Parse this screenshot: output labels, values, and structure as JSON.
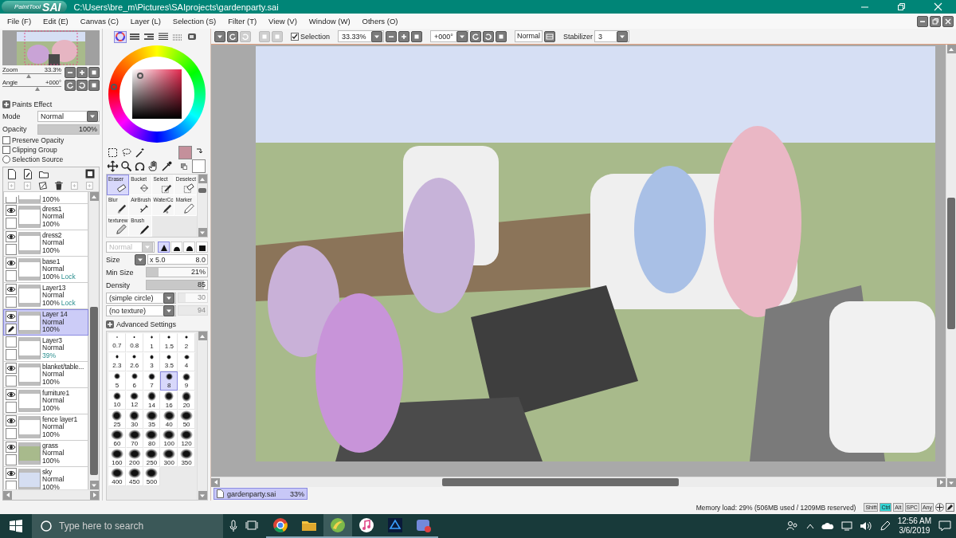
{
  "window": {
    "logo_small": "PaintTool",
    "logo_big": "SAI",
    "title": "C:\\Users\\bre_m\\Pictures\\SAIprojects\\gardenparty.sai"
  },
  "menu": [
    "File (F)",
    "Edit (E)",
    "Canvas (C)",
    "Layer (L)",
    "Selection (S)",
    "Filter (T)",
    "View (V)",
    "Window (W)",
    "Others (O)"
  ],
  "toolbar": {
    "selection": {
      "label": "Selection",
      "checked": true
    },
    "zoom": "33.33%",
    "angle": "+000°",
    "blend": "Normal",
    "stabilizer_label": "Stabilizer",
    "stabilizer": "3"
  },
  "navigator": {
    "sliders": [
      {
        "label": "Zoom",
        "reading": "33.3%",
        "level": 0.45
      },
      {
        "label": "Angle",
        "reading": "+000°",
        "level": 0.6
      }
    ]
  },
  "paints_effect": {
    "title": "Paints Effect",
    "mode_label": "Mode",
    "mode": "Normal",
    "opacity_label": "Opacity",
    "opacity": "100%",
    "level": 1,
    "options": [
      {
        "label": "Preserve Opacity",
        "kind": "checkbox",
        "checked": false
      },
      {
        "label": "Clipping Group",
        "kind": "checkbox",
        "checked": false
      },
      {
        "label": "Selection Source",
        "kind": "radio",
        "checked": false
      }
    ]
  },
  "layers": [
    {
      "kind": "cut",
      "opacity": "100%"
    },
    {
      "kind": "layer",
      "name": "dress1",
      "mode": "Normal",
      "opacity": "100%",
      "visible": true,
      "selected": false,
      "color": "#ffffff"
    },
    {
      "kind": "layer",
      "name": "dress2",
      "mode": "Normal",
      "opacity": "100%",
      "visible": true,
      "selected": false,
      "color": "#ffffff"
    },
    {
      "kind": "layer",
      "name": "base1",
      "mode": "Normal",
      "opacity": "100%",
      "lock": "Lock",
      "visible": true,
      "selected": false,
      "color": "#ffffff"
    },
    {
      "kind": "layer",
      "name": "Layer13",
      "mode": "Normal",
      "opacity": "100%",
      "lock": "Lock",
      "visible": true,
      "selected": false,
      "color": "#ffffff"
    },
    {
      "kind": "layer",
      "name": "Layer 14",
      "mode": "Normal",
      "opacity": "100%",
      "visible": true,
      "selected": true,
      "color": "#ffffff"
    },
    {
      "kind": "layer",
      "name": "Layer3",
      "mode": "Normal",
      "opacity": "39%",
      "opacity_modified": true,
      "visible": false,
      "selected": false,
      "color": "#ffffff"
    },
    {
      "kind": "layer",
      "name": "blanket/table...",
      "mode": "Normal",
      "opacity": "100%",
      "visible": true,
      "selected": false,
      "color": "#ffffff"
    },
    {
      "kind": "layer",
      "name": "furniture1",
      "mode": "Normal",
      "opacity": "100%",
      "visible": true,
      "selected": false,
      "color": "#ffffff"
    },
    {
      "kind": "layer",
      "name": "fence layer1",
      "mode": "Normal",
      "opacity": "100%",
      "visible": true,
      "selected": false,
      "color": "#ffffff"
    },
    {
      "kind": "layer",
      "name": "grass",
      "mode": "Normal",
      "opacity": "100%",
      "visible": true,
      "selected": false,
      "color": "#a8ba8c"
    },
    {
      "kind": "layer",
      "name": "sky",
      "mode": "Normal",
      "opacity": "100%",
      "visible": true,
      "selected": false,
      "color": "#d5def2"
    }
  ],
  "palette_modes": [
    {
      "selected": true
    },
    {
      "selected": false
    },
    {
      "selected": false
    },
    {
      "selected": false
    },
    {
      "selected": false
    },
    {
      "selected": false
    }
  ],
  "colors": [
    {
      "color": "#c4909b"
    },
    {
      "color": "#ffffff"
    }
  ],
  "tools": [
    {
      "label": "Eraser",
      "selected": true
    },
    {
      "label": "Bucket",
      "selected": false
    },
    {
      "label": "Select",
      "selected": false
    },
    {
      "label": "Deselect",
      "selected": false
    },
    {
      "label": "Blur",
      "selected": false
    },
    {
      "label": "AirBrush",
      "selected": false
    },
    {
      "label": "WaterCc",
      "selected": false
    },
    {
      "label": "Marker",
      "selected": false
    },
    {
      "label": "texturew",
      "selected": false
    },
    {
      "label": "Brush",
      "selected": false
    }
  ],
  "brush": {
    "blend": "Normal",
    "blend_disabled": true,
    "tip_shapes": [
      {
        "selected": true
      },
      {
        "selected": false
      },
      {
        "selected": false
      },
      {
        "selected": false
      }
    ],
    "size_label": "Size",
    "size_multiplier": "x 5.0",
    "size": "8.0",
    "bars": [
      {
        "label": "Min Size",
        "reading": "21%",
        "level": 0.2
      },
      {
        "label": "Density",
        "reading": "85",
        "level": 0.95
      }
    ],
    "pickers": [
      {
        "value": "(simple circle)",
        "reading": "30",
        "level": 0.25
      },
      {
        "value": "(no texture)",
        "reading": "94",
        "level": 1
      }
    ],
    "advanced": "Advanced Settings"
  },
  "brush_sizes": [
    {
      "label": "0.7",
      "selected": false
    },
    {
      "label": "0.8",
      "selected": false
    },
    {
      "label": "1",
      "selected": false
    },
    {
      "label": "1.5",
      "selected": false
    },
    {
      "label": "2",
      "selected": false
    },
    {
      "label": "2.3",
      "selected": false
    },
    {
      "label": "2.6",
      "selected": false
    },
    {
      "label": "3",
      "selected": false
    },
    {
      "label": "3.5",
      "selected": false
    },
    {
      "label": "4",
      "selected": false
    },
    {
      "label": "5",
      "selected": false
    },
    {
      "label": "6",
      "selected": false
    },
    {
      "label": "7",
      "selected": false
    },
    {
      "label": "8",
      "selected": true
    },
    {
      "label": "9",
      "selected": false
    },
    {
      "label": "10",
      "selected": false
    },
    {
      "label": "12",
      "selected": false
    },
    {
      "label": "14",
      "selected": false
    },
    {
      "label": "16",
      "selected": false
    },
    {
      "label": "20",
      "selected": false
    },
    {
      "label": "25",
      "selected": false
    },
    {
      "label": "30",
      "selected": false
    },
    {
      "label": "35",
      "selected": false
    },
    {
      "label": "40",
      "selected": false
    },
    {
      "label": "50",
      "selected": false
    },
    {
      "label": "60",
      "selected": false
    },
    {
      "label": "70",
      "selected": false
    },
    {
      "label": "80",
      "selected": false
    },
    {
      "label": "100",
      "selected": false
    },
    {
      "label": "120",
      "selected": false
    },
    {
      "label": "160",
      "selected": false
    },
    {
      "label": "200",
      "selected": false
    },
    {
      "label": "250",
      "selected": false
    },
    {
      "label": "300",
      "selected": false
    },
    {
      "label": "350",
      "selected": false
    },
    {
      "label": "400",
      "selected": false
    },
    {
      "label": "450",
      "selected": false
    },
    {
      "label": "500",
      "selected": false
    }
  ],
  "canvas": {
    "kind": "picture"
  },
  "file_tabs": [
    {
      "name": "gardenparty.sai",
      "zoom": "33%",
      "selected": true
    }
  ],
  "status": {
    "memory": "Memory load: 29% (506MB used / 1209MB reserved)",
    "keys": [
      {
        "label": "Shift",
        "on": false
      },
      {
        "label": "Ctrl",
        "on": true
      },
      {
        "label": "Alt",
        "on": false
      },
      {
        "label": "SPC",
        "on": false
      },
      {
        "label": "Any",
        "on": false
      }
    ]
  },
  "taskbar": {
    "search_placeholder": "Type here to search",
    "apps": [
      {
        "selected": false
      },
      {
        "selected": false
      },
      {
        "selected": true
      },
      {
        "selected": false
      },
      {
        "selected": false
      },
      {
        "selected": false
      }
    ],
    "time": "12:56 AM",
    "date": "3/6/2019"
  }
}
